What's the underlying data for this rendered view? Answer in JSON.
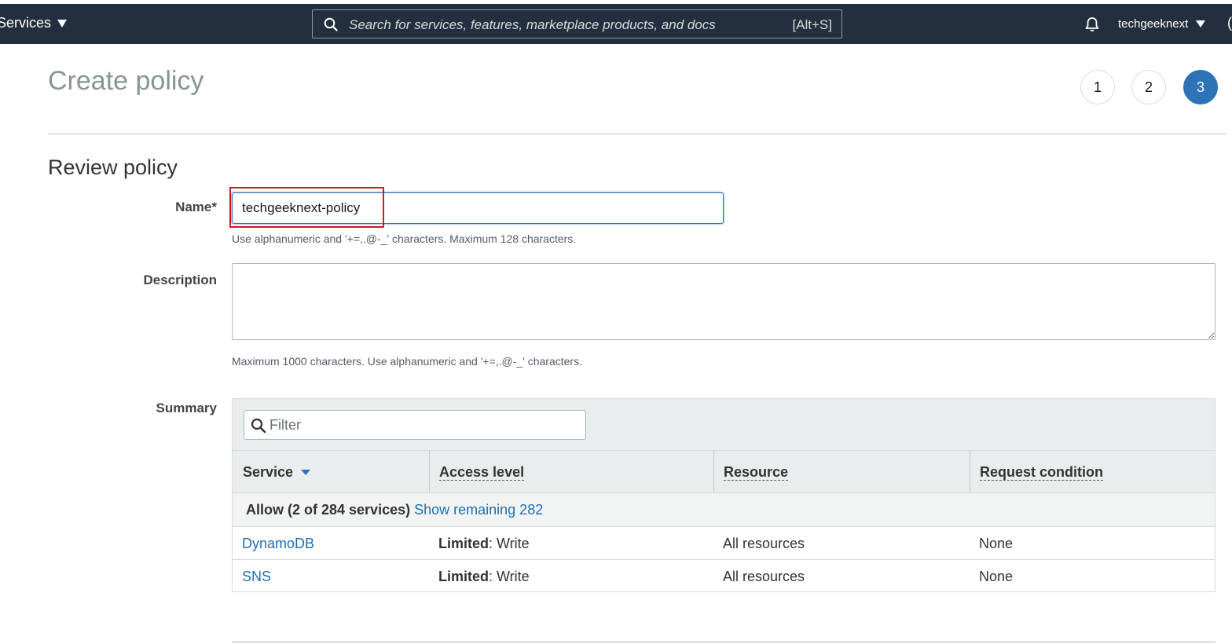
{
  "nav": {
    "services_label": "Services",
    "search_placeholder": "Search for services, features, marketplace products, and docs",
    "search_shortcut": "[Alt+S]",
    "user": "techgeeknext"
  },
  "header": {
    "title": "Create policy",
    "steps": [
      "1",
      "2",
      "3"
    ],
    "active_step": "3"
  },
  "review": {
    "title": "Review policy",
    "name_label": "Name*",
    "name_value": "techgeeknext-policy",
    "name_hint": "Use alphanumeric and '+=,.@-_' characters. Maximum 128 characters.",
    "description_label": "Description",
    "description_value": "",
    "description_hint": "Maximum 1000 characters. Use alphanumeric and '+=,.@-_' characters.",
    "summary_label": "Summary"
  },
  "summary": {
    "filter_placeholder": "Filter",
    "columns": [
      "Service",
      "Access level",
      "Resource",
      "Request condition"
    ],
    "group_label": "Allow (2 of 284 services)",
    "group_link": "Show remaining 282",
    "rows": [
      {
        "service": "DynamoDB",
        "access_bold": "Limited",
        "access_rest": ": Write",
        "resource": "All resources",
        "condition": "None"
      },
      {
        "service": "SNS",
        "access_bold": "Limited",
        "access_rest": ": Write",
        "resource": "All resources",
        "condition": "None"
      }
    ]
  },
  "colors": {
    "nav_bg": "#232f3e",
    "primary": "#2e73b8",
    "link": "#1f6fb2",
    "highlight": "#d0181f"
  }
}
